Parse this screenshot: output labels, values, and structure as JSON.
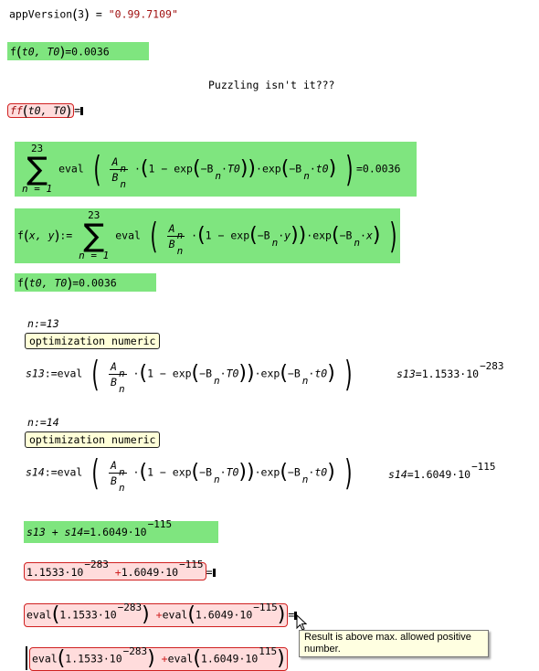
{
  "version_line": {
    "fn": "appVersion",
    "arg": "3",
    "eq": "=",
    "value": "\"0.99.7109\""
  },
  "line_f_top": {
    "fn": "f",
    "args": "t0, T0",
    "eq": "=",
    "value": "0.0036"
  },
  "puzzle_text": "Puzzling isn't it???",
  "line_ff": {
    "fn": "ff",
    "args": "t0, T0",
    "eq": "="
  },
  "sum_eval": {
    "sigma": "∑",
    "upper": "23",
    "lower": "n = 1",
    "eval": "eval",
    "A": "A",
    "B": "B",
    "n": "n",
    "one_minus": "1 − exp",
    "neg_B": "−B",
    "T0": "T0",
    "t0": "t0",
    "exp": "exp",
    "dot": "·",
    "eq": "=",
    "value": "0.0036"
  },
  "f_def": {
    "lhs": "f",
    "args": "x, y",
    "def": ":=",
    "upper": "23",
    "lower": "n = 1",
    "y": "y",
    "x": "x"
  },
  "line_f_mid": {
    "fn": "f",
    "args": "t0, T0",
    "eq": "=",
    "value": "0.0036"
  },
  "n13": {
    "lhs": "n",
    "def": ":=",
    "value": "13"
  },
  "opt_label_1": "optimization numeric",
  "s13": {
    "name": "s13",
    "def": ":=",
    "result_name": "s13",
    "eq": "=",
    "mantissa": "1.1533",
    "times": "·",
    "base": "10",
    "exponent": "−283"
  },
  "n14": {
    "lhs": "n",
    "def": ":=",
    "value": "14"
  },
  "opt_label_2": "optimization numeric",
  "s14": {
    "name": "s14",
    "def": ":=",
    "result_name": "s14",
    "eq": "=",
    "mantissa": "1.6049",
    "times": "·",
    "base": "10",
    "exponent": "−115"
  },
  "sum_s": {
    "expr": "s13 + s14",
    "eq": "=",
    "mantissa": "1.6049",
    "base": "10",
    "exponent": "−115"
  },
  "err_line_1": {
    "m1": "1.1533",
    "e1": "−283",
    "plus": "+",
    "m2": "1.6049",
    "e2": "−115",
    "base": "10",
    "eq": "="
  },
  "err_line_2": {
    "eval": "eval",
    "m1": "1.1533",
    "e1": "−283",
    "plus": "+",
    "m2": "1.6049",
    "e2": "−115",
    "base": "10",
    "eq": "="
  },
  "tooltip": "Result is above max. allowed positive number.",
  "err_line_3": {
    "eval": "eval",
    "m1": "1.1533",
    "e1": "−283",
    "plus": "+",
    "m2": "1.6049",
    "e2": "115",
    "base": "10"
  },
  "colors": {
    "green": "#7fe57f",
    "error_red": "#d02020",
    "error_bg": "#ffdcdc",
    "string_red": "#a01010",
    "label_bg": "#ffffd8",
    "tooltip_bg": "#ffffe1"
  }
}
